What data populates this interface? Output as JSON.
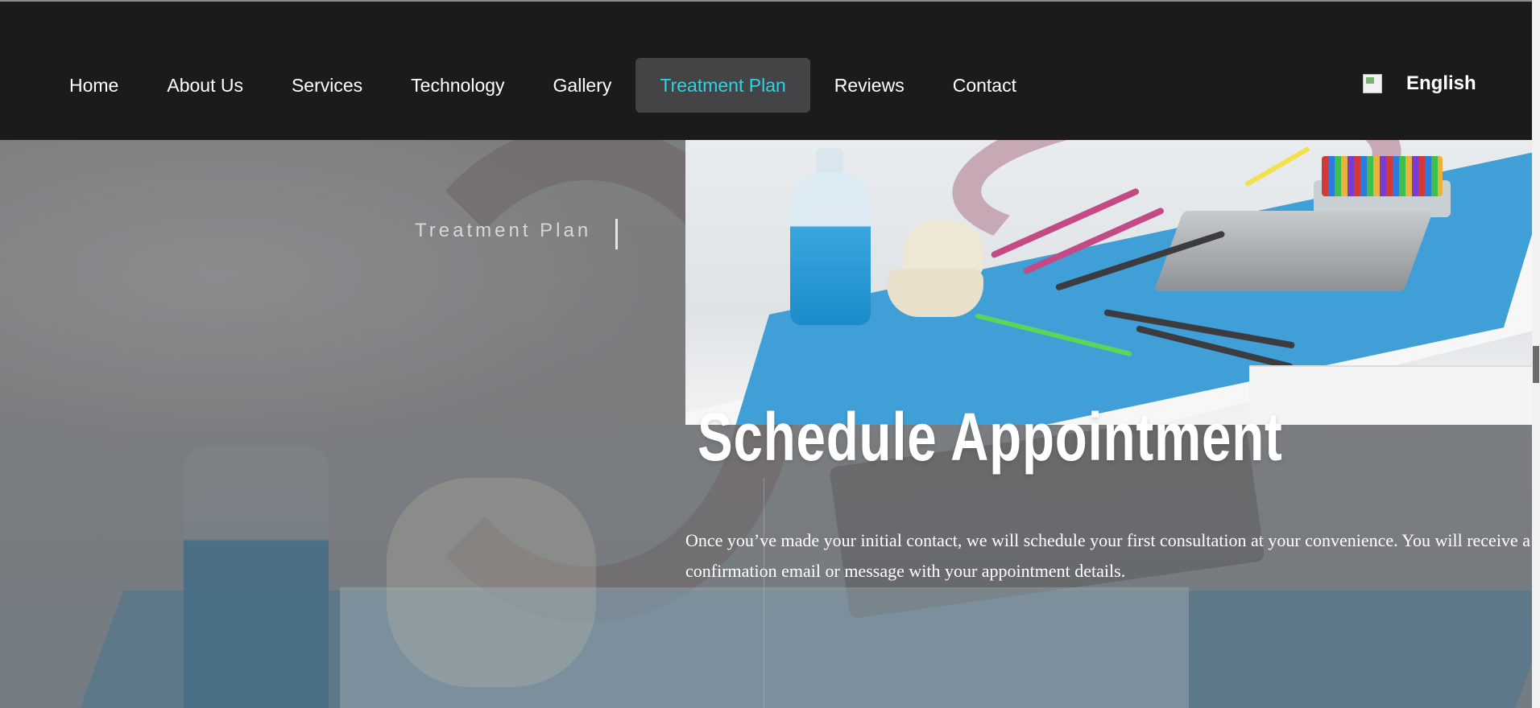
{
  "nav": {
    "items": [
      {
        "label": "Home"
      },
      {
        "label": "About Us"
      },
      {
        "label": "Services"
      },
      {
        "label": "Technology"
      },
      {
        "label": "Gallery"
      },
      {
        "label": "Treatment Plan",
        "active": true
      },
      {
        "label": "Reviews"
      },
      {
        "label": "Contact"
      }
    ],
    "language": {
      "label": "English",
      "icon": "flag-icon"
    },
    "active_color": "#2ed3e4",
    "background_color": "#1b1b1b"
  },
  "hero": {
    "section_label": "Treatment Plan",
    "heading": "Schedule Appointment",
    "body": "Once you’ve made your initial contact, we will schedule your first consultation at your convenience. You will receive a confirmation email or message with your appointment details."
  }
}
